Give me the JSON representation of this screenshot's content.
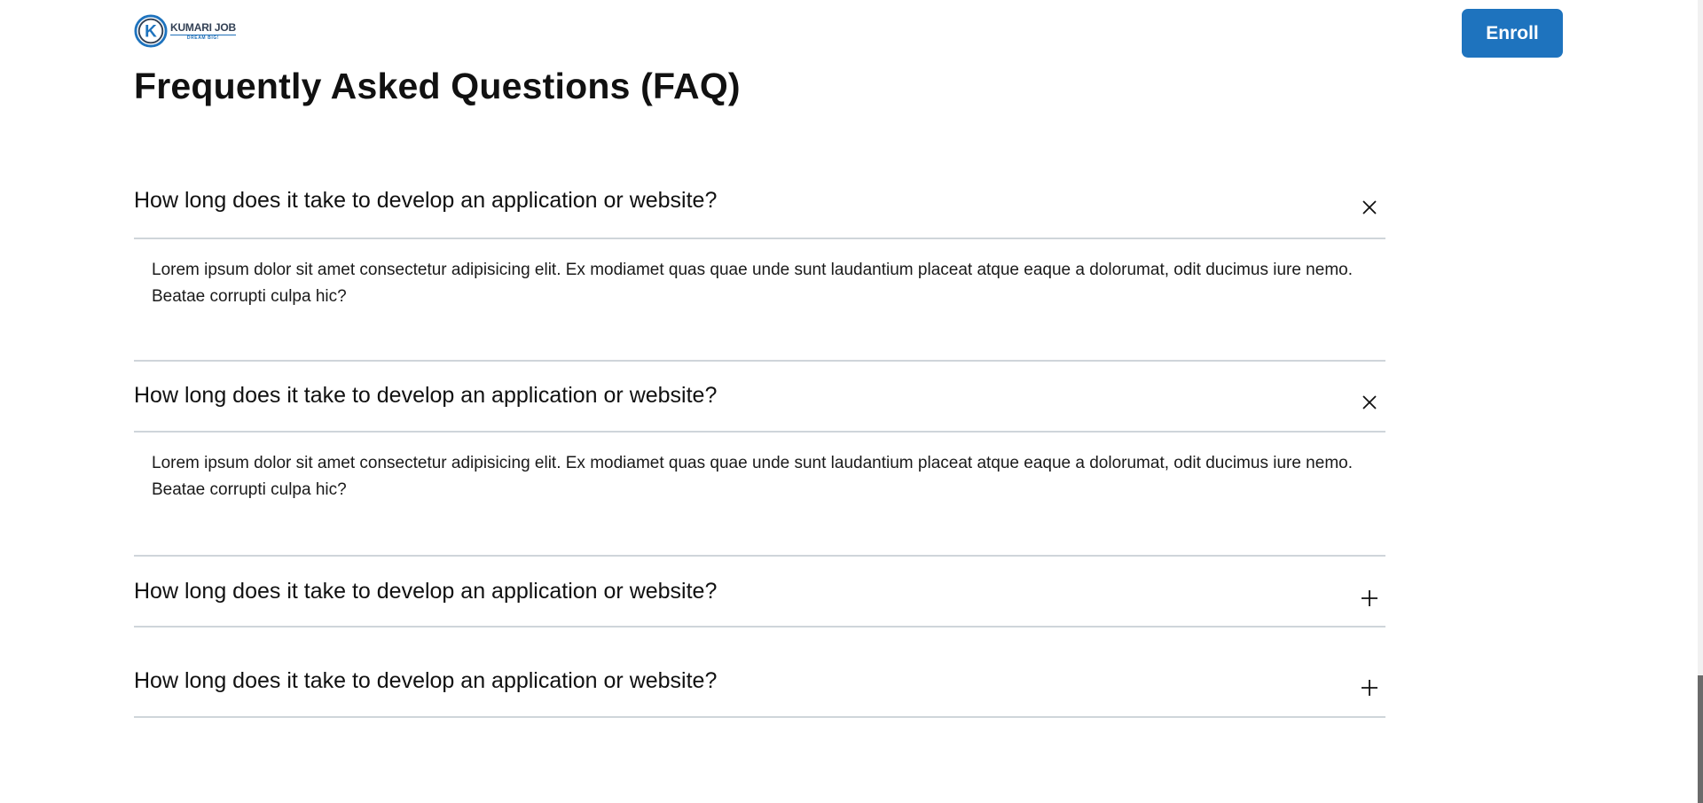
{
  "header": {
    "logo_name": "KUMARI JOB",
    "logo_tagline": "DREAM BIG!",
    "logo_letter": "K",
    "enroll_label": "Enroll"
  },
  "faq": {
    "title": "Frequently Asked Questions (FAQ)",
    "items": [
      {
        "question": "How long does it take to develop an application or website?",
        "answer": "Lorem ipsum dolor sit amet consectetur adipisicing elit. Ex modiamet quas quae unde sunt laudantium placeat atque eaque a dolorumat, odit ducimus iure nemo. Beatae corrupti culpa hic?",
        "expanded": true,
        "toggle_icon": "close-icon"
      },
      {
        "question": "How long does it take to develop an application or website?",
        "answer": "Lorem ipsum dolor sit amet consectetur adipisicing elit. Ex modiamet quas quae unde sunt laudantium placeat atque eaque a dolorumat, odit ducimus iure nemo. Beatae corrupti culpa hic?",
        "expanded": true,
        "toggle_icon": "close-icon"
      },
      {
        "question": "How long does it take to develop an application or website?",
        "expanded": false,
        "toggle_icon": "plus-icon"
      },
      {
        "question": "How long does it take to develop an application or website?",
        "expanded": false,
        "toggle_icon": "plus-icon"
      }
    ]
  },
  "colors": {
    "brand_blue": "#1e73be",
    "divider": "#cfd5da",
    "text": "#111111"
  }
}
